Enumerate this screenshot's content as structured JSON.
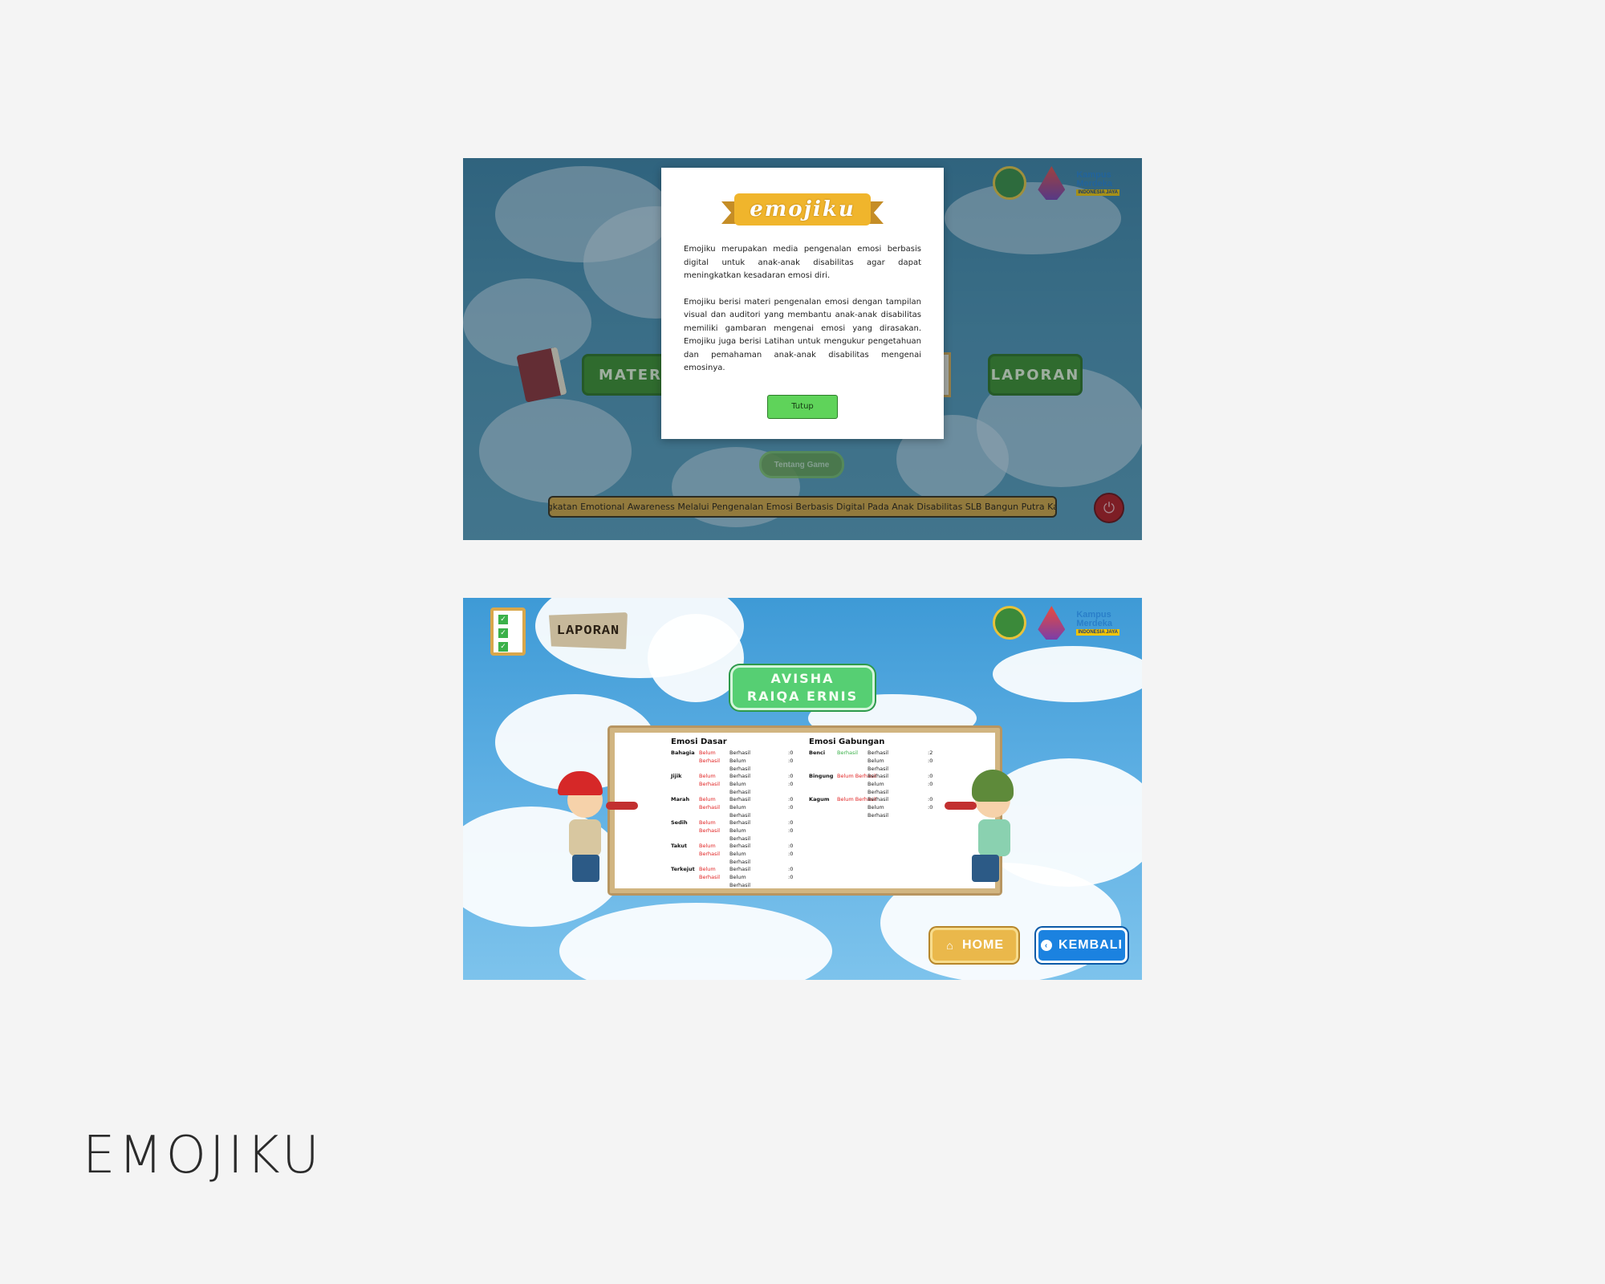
{
  "brand_title": "EMOJIKU",
  "screen1": {
    "logos": [
      "school-emblem-icon",
      "university-logo-icon",
      "kampus-merdeka-logo"
    ],
    "kampus_merdeka": {
      "line1": "Kampus",
      "line2": "Merdeka",
      "tag": "INDONESIA JAYA"
    },
    "menu": {
      "materi": "MATERI",
      "laporan": "LAPORAN"
    },
    "tentang_label": "Tentang Game",
    "footer_text": "Peningkatan Emotional Awareness Melalui Pengenalan Emosi Berbasis Digital Pada Anak Disabilitas SLB Bangun Putra Kasihan",
    "modal": {
      "logo_text": "emojiku",
      "paragraph1": "Emojiku merupakan media pengenalan emosi berbasis digital untuk anak-anak disabilitas agar dapat meningkatkan kesadaran emosi diri.",
      "paragraph2": "Emojiku berisi materi pengenalan emosi dengan tampilan visual dan auditori yang membantu anak-anak disabilitas memiliki gambaran mengenai emosi yang dirasakan. Emojiku juga berisi Latihan untuk mengukur pengetahuan dan pemahaman anak-anak disabilitas mengenai emosinya.",
      "close_label": "Tutup"
    }
  },
  "screen2": {
    "header_label": "LAPORAN",
    "kampus_merdeka": {
      "line1": "Kampus",
      "line2": "Merdeka",
      "tag": "INDONESIA JAYA"
    },
    "student_name": "AVISHA RAIQA ERNIS",
    "emosi_dasar": {
      "title": "Emosi Dasar",
      "rows": [
        {
          "name": "Bahagia",
          "status": "Belum Berhasil",
          "success": false,
          "berhasil": 0,
          "belum": 0
        },
        {
          "name": "Jijik",
          "status": "Belum Berhasil",
          "success": false,
          "berhasil": 0,
          "belum": 0
        },
        {
          "name": "Marah",
          "status": "Belum Berhasil",
          "success": false,
          "berhasil": 0,
          "belum": 0
        },
        {
          "name": "Sedih",
          "status": "Belum Berhasil",
          "success": false,
          "berhasil": 0,
          "belum": 0
        },
        {
          "name": "Takut",
          "status": "Belum Berhasil",
          "success": false,
          "berhasil": 0,
          "belum": 0
        },
        {
          "name": "Terkejut",
          "status": "Belum Berhasil",
          "success": false,
          "berhasil": 0,
          "belum": 0
        }
      ]
    },
    "emosi_gabungan": {
      "title": "Emosi Gabungan",
      "rows": [
        {
          "name": "Benci",
          "status": "Berhasil",
          "success": true,
          "berhasil": 2,
          "belum": 0
        },
        {
          "name": "Bingung",
          "status": "Belum Berhasil",
          "success": false,
          "berhasil": 0,
          "belum": 0
        },
        {
          "name": "Kagum",
          "status": "Belum Berhasil",
          "success": false,
          "berhasil": 0,
          "belum": 0
        }
      ]
    },
    "label_berhasil": "Berhasil",
    "label_belum": "Belum Berhasil",
    "home_label": "HOME",
    "kembali_label": "KEMBALI"
  },
  "colors": {
    "page_bg": "#f4f4f4",
    "fail_red": "#e12424",
    "success_green": "#3bb14a",
    "tutup_green": "#5fd35a",
    "home_yellow": "#eab84b",
    "kembali_blue": "#1b82e0"
  }
}
